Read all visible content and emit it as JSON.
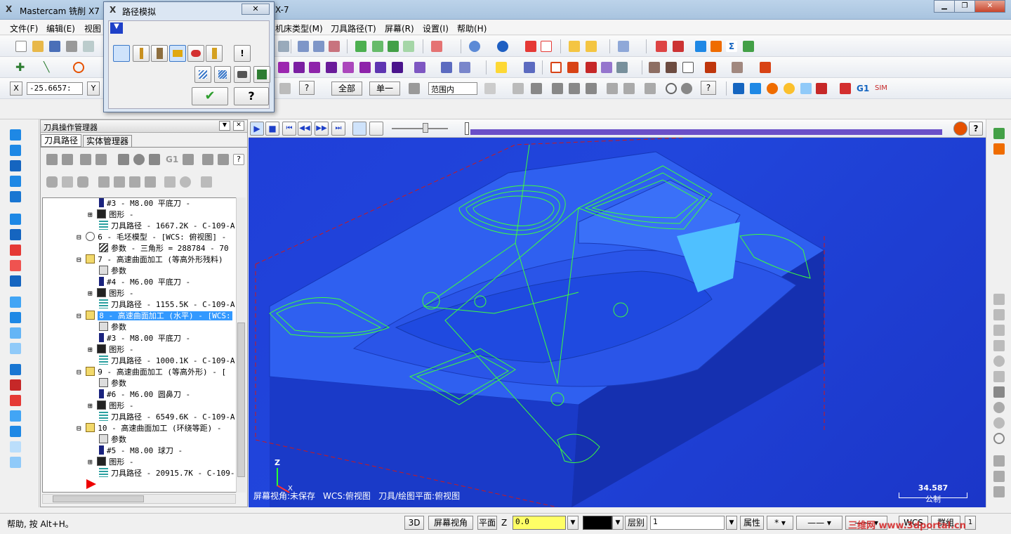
{
  "window": {
    "title": "Mastercam 铣削 X7",
    "title_suffix": "X-7"
  },
  "menu": [
    "文件(F)",
    "编辑(E)",
    "视图",
    "机床类型(M)",
    "刀具路径(T)",
    "屏幕(R)",
    "设置(I)",
    "帮助(H)"
  ],
  "coords": {
    "x_label": "X",
    "x_value": "-25.6657:",
    "y_label": "Y"
  },
  "selection_bar": {
    "all_label": "全部",
    "single_label": "单一",
    "range_value": "范围内"
  },
  "toolbar3_tail": {
    "g1": "G1",
    "sim": "SIM"
  },
  "dialog": {
    "title": "路径模拟"
  },
  "manager": {
    "title": "刀具操作管理器",
    "tabs": [
      "刀具路径",
      "实体管理器"
    ],
    "tree": [
      "#3 - M8.00 平底刀 -",
      "图形 -",
      "刀具路径 - 1667.2K - C-109-A",
      "6 - 毛坯模型 - [WCS: 俯视图] -",
      "参数 - 三角形 = 288784 - 70",
      "7 - 高速曲面加工 (等高外形残料)",
      "参数",
      "#4 - M6.00 平底刀 -",
      "图形 -",
      "刀具路径 - 1155.5K - C-109-A",
      "8 - 高速曲面加工 (水平) - [WCS:",
      "参数",
      "#3 - M8.00 平底刀 -",
      "图形 -",
      "刀具路径 - 1000.1K - C-109-A",
      "9 - 高速曲面加工 (等高外形) - [",
      "参数",
      "#6 - M6.00 圆鼻刀 -",
      "图形 -",
      "刀具路径 - 6549.6K - C-109-A",
      "10 - 高速曲面加工 (环绕等距) -",
      "参数",
      "#5 - M8.00 球刀 -",
      "图形 -",
      "刀具路径 - 20915.7K - C-109-"
    ]
  },
  "viewport": {
    "status_view": "屏幕视角:未保存",
    "status_wcs": "WCS:俯视图",
    "status_plane": "刀具/绘图平面:俯视图",
    "scale_value": "34.587",
    "scale_unit": "公制",
    "axis_z": "Z",
    "axis_x": "X"
  },
  "statusbar": {
    "help": "帮助, 按 Alt+H。",
    "btn_3d": "3D",
    "btn_view": "屏幕视角",
    "btn_plane": "平面",
    "z_label": "Z",
    "z_value": "0.0",
    "level_label": "层别",
    "level_value": "1",
    "attr_label": "属性",
    "wcs_label": "WCS",
    "group_label": "群组"
  },
  "watermark": "三维网 www.3dportal.cn",
  "colors": {
    "viewport": "#2146dc",
    "toolpath": "#3dff3d",
    "selected": "#3399ff",
    "progress": "#6a4fc8"
  }
}
